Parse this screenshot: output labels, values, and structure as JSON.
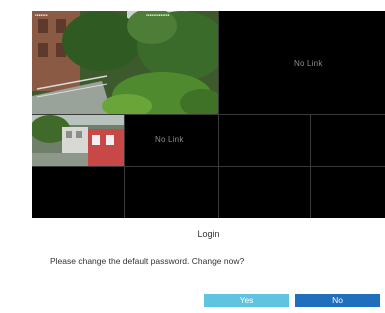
{
  "video_wall": {
    "channels": [
      {
        "id": 1,
        "status": "live",
        "scene": "garden-stairs"
      },
      {
        "id": 2,
        "status": "no-link",
        "label": "No Link"
      },
      {
        "id": 3,
        "status": "live",
        "scene": "building-yard"
      },
      {
        "id": 4,
        "status": "no-link",
        "label": "No Link"
      },
      {
        "id": 5,
        "status": "empty"
      },
      {
        "id": 6,
        "status": "empty"
      },
      {
        "id": 7,
        "status": "empty"
      },
      {
        "id": 8,
        "status": "empty"
      },
      {
        "id": 9,
        "status": "empty"
      },
      {
        "id": 10,
        "status": "empty"
      }
    ],
    "colors": {
      "background": "#000000",
      "gridline": "#3a3a3a",
      "no_link_text": "#8c8c8c"
    }
  },
  "dialog": {
    "title": "Login",
    "message": "Please change the default password. Change now?",
    "yes_label": "Yes",
    "no_label": "No",
    "colors": {
      "yes_button": "#5fc4e2",
      "no_button": "#1f6fbd"
    }
  }
}
